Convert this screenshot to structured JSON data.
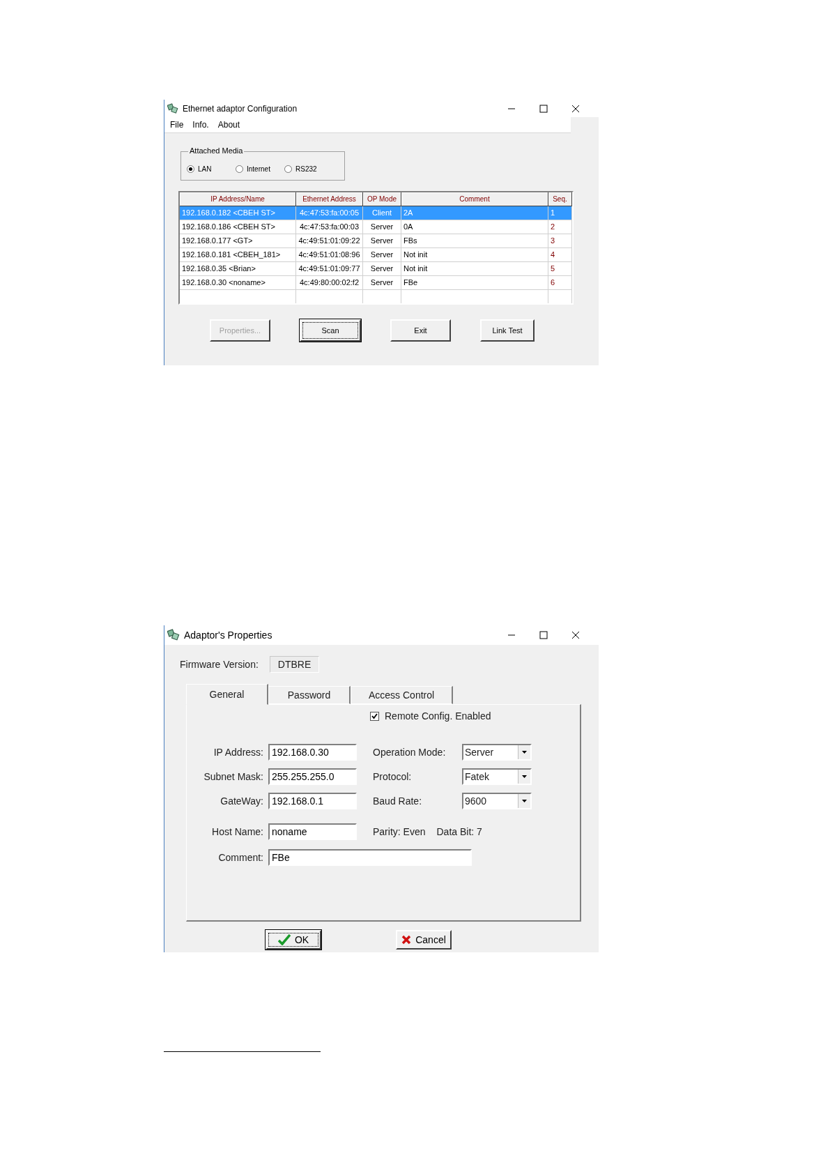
{
  "config_window": {
    "title": "Ethernet adaptor Configuration",
    "menu": [
      "File",
      "Info.",
      "About"
    ],
    "attached_media": {
      "label": "Attached Media",
      "options": [
        {
          "label": "LAN",
          "selected": true
        },
        {
          "label": "Internet",
          "selected": false
        },
        {
          "label": "RS232",
          "selected": false
        }
      ]
    },
    "table": {
      "columns": [
        "IP Address/Name",
        "Ethernet Address",
        "OP Mode",
        "Comment",
        "Seq."
      ],
      "rows": [
        {
          "ip_name": "192.168.0.182 <CBEH ST>",
          "ethernet_address": "4c:47:53:fa:00:05",
          "op_mode": "Client",
          "comment": "2A",
          "seq": "1",
          "selected": true
        },
        {
          "ip_name": "192.168.0.186 <CBEH ST>",
          "ethernet_address": "4c:47:53:fa:00:03",
          "op_mode": "Server",
          "comment": "0A",
          "seq": "2",
          "selected": false
        },
        {
          "ip_name": "192.168.0.177 <GT>",
          "ethernet_address": "4c:49:51:01:09:22",
          "op_mode": "Server",
          "comment": "FBs",
          "seq": "3",
          "selected": false
        },
        {
          "ip_name": "192.168.0.181 <CBEH_181>",
          "ethernet_address": "4c:49:51:01:08:96",
          "op_mode": "Server",
          "comment": "Not init",
          "seq": "4",
          "selected": false
        },
        {
          "ip_name": "192.168.0.35 <Brian>",
          "ethernet_address": "4c:49:51:01:09:77",
          "op_mode": "Server",
          "comment": "Not init",
          "seq": "5",
          "selected": false
        },
        {
          "ip_name": "192.168.0.30 <noname>",
          "ethernet_address": "4c:49:80:00:02:f2",
          "op_mode": "Server",
          "comment": "FBe",
          "seq": "6",
          "selected": false
        }
      ]
    },
    "buttons": [
      {
        "label": "Properties...",
        "disabled": true,
        "focused": false
      },
      {
        "label": "Scan",
        "disabled": false,
        "focused": true
      },
      {
        "label": "Exit",
        "disabled": false,
        "focused": false
      },
      {
        "label": "Link Test",
        "disabled": false,
        "focused": false
      }
    ]
  },
  "properties_window": {
    "title": "Adaptor's Properties",
    "firmware_version": {
      "label": "Firmware Version:",
      "value": "DTBRE"
    },
    "tabs": [
      {
        "label": "General",
        "selected": true
      },
      {
        "label": "Password",
        "selected": false
      },
      {
        "label": "Access Control",
        "selected": false
      }
    ],
    "remote_config": {
      "label": "Remote Config. Enabled",
      "checked": true
    },
    "fields": [
      {
        "label": "IP Address:",
        "value": "192.168.0.30"
      },
      {
        "label": "Subnet Mask:",
        "value": "255.255.255.0"
      },
      {
        "label": "GateWay:",
        "value": "192.168.0.1"
      },
      {
        "label": "Host Name:",
        "value": "noname"
      }
    ],
    "settings": [
      {
        "label": "Operation Mode:",
        "value": "Server"
      },
      {
        "label": "Protocol:",
        "value": "Fatek"
      },
      {
        "label": "Baud Rate:",
        "value": "9600"
      }
    ],
    "parity": "Parity: Even",
    "data_bit": "Data Bit: 7",
    "comment": {
      "label": "Comment:",
      "value": "FBe"
    },
    "buttons": [
      {
        "label": "OK",
        "kind": "confirm",
        "focused": true
      },
      {
        "label": "Cancel",
        "kind": "cancel",
        "focused": false
      }
    ]
  }
}
